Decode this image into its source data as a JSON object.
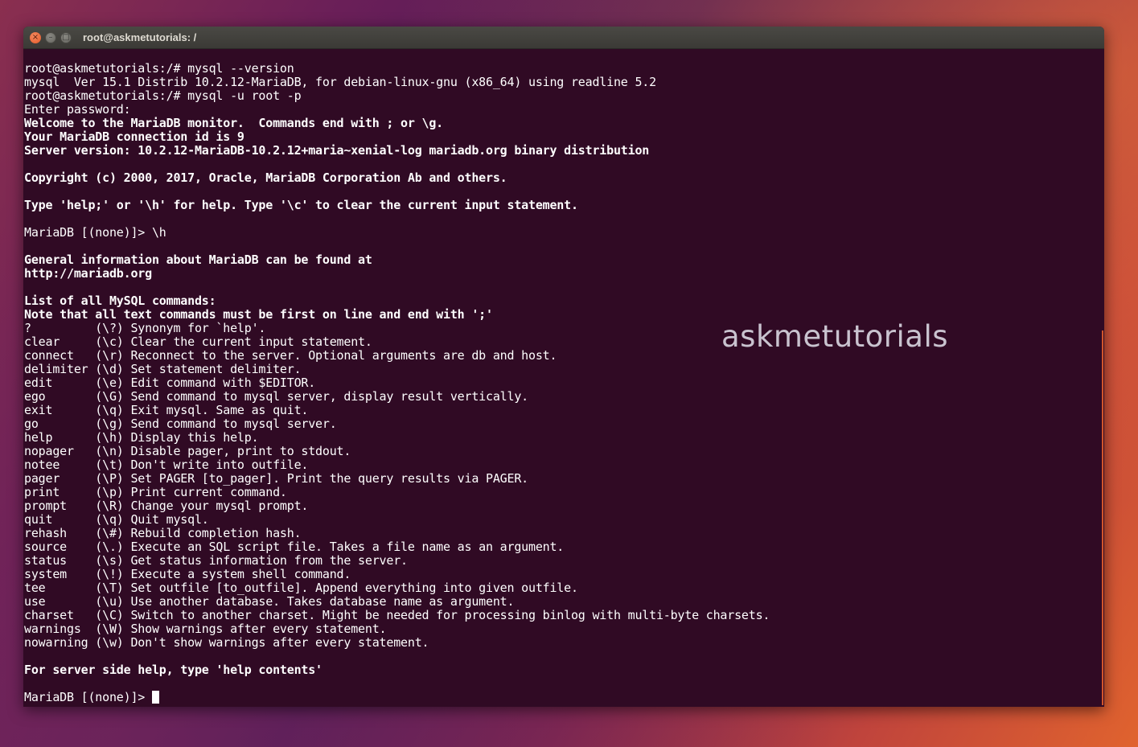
{
  "window": {
    "title": "root@askmetutorials: /",
    "buttons": {
      "close": "×",
      "minimize": "–",
      "maximize": "□"
    }
  },
  "watermark": "askmetutorials",
  "terminal": {
    "lines": [
      {
        "text": "root@askmetutorials:/# mysql --version",
        "bold": false
      },
      {
        "text": "mysql  Ver 15.1 Distrib 10.2.12-MariaDB, for debian-linux-gnu (x86_64) using readline 5.2",
        "bold": false
      },
      {
        "text": "root@askmetutorials:/# mysql -u root -p",
        "bold": false
      },
      {
        "text": "Enter password:",
        "bold": false
      },
      {
        "text": "Welcome to the MariaDB monitor.  Commands end with ; or \\g.",
        "bold": true
      },
      {
        "text": "Your MariaDB connection id is 9",
        "bold": true
      },
      {
        "text": "Server version: 10.2.12-MariaDB-10.2.12+maria~xenial-log mariadb.org binary distribution",
        "bold": true
      },
      {
        "text": "",
        "bold": false
      },
      {
        "text": "Copyright (c) 2000, 2017, Oracle, MariaDB Corporation Ab and others.",
        "bold": true
      },
      {
        "text": "",
        "bold": false
      },
      {
        "text": "Type 'help;' or '\\h' for help. Type '\\c' to clear the current input statement.",
        "bold": true
      },
      {
        "text": "",
        "bold": false
      },
      {
        "text": "MariaDB [(none)]> \\h",
        "bold": false
      },
      {
        "text": "",
        "bold": false
      },
      {
        "text": "General information about MariaDB can be found at",
        "bold": true
      },
      {
        "text": "http://mariadb.org",
        "bold": true
      },
      {
        "text": "",
        "bold": false
      },
      {
        "text": "List of all MySQL commands:",
        "bold": true
      },
      {
        "text": "Note that all text commands must be first on line and end with ';'",
        "bold": true
      },
      {
        "text": "?         (\\?) Synonym for `help'.",
        "bold": false
      },
      {
        "text": "clear     (\\c) Clear the current input statement.",
        "bold": false
      },
      {
        "text": "connect   (\\r) Reconnect to the server. Optional arguments are db and host.",
        "bold": false
      },
      {
        "text": "delimiter (\\d) Set statement delimiter.",
        "bold": false
      },
      {
        "text": "edit      (\\e) Edit command with $EDITOR.",
        "bold": false
      },
      {
        "text": "ego       (\\G) Send command to mysql server, display result vertically.",
        "bold": false
      },
      {
        "text": "exit      (\\q) Exit mysql. Same as quit.",
        "bold": false
      },
      {
        "text": "go        (\\g) Send command to mysql server.",
        "bold": false
      },
      {
        "text": "help      (\\h) Display this help.",
        "bold": false
      },
      {
        "text": "nopager   (\\n) Disable pager, print to stdout.",
        "bold": false
      },
      {
        "text": "notee     (\\t) Don't write into outfile.",
        "bold": false
      },
      {
        "text": "pager     (\\P) Set PAGER [to_pager]. Print the query results via PAGER.",
        "bold": false
      },
      {
        "text": "print     (\\p) Print current command.",
        "bold": false
      },
      {
        "text": "prompt    (\\R) Change your mysql prompt.",
        "bold": false
      },
      {
        "text": "quit      (\\q) Quit mysql.",
        "bold": false
      },
      {
        "text": "rehash    (\\#) Rebuild completion hash.",
        "bold": false
      },
      {
        "text": "source    (\\.) Execute an SQL script file. Takes a file name as an argument.",
        "bold": false
      },
      {
        "text": "status    (\\s) Get status information from the server.",
        "bold": false
      },
      {
        "text": "system    (\\!) Execute a system shell command.",
        "bold": false
      },
      {
        "text": "tee       (\\T) Set outfile [to_outfile]. Append everything into given outfile.",
        "bold": false
      },
      {
        "text": "use       (\\u) Use another database. Takes database name as argument.",
        "bold": false
      },
      {
        "text": "charset   (\\C) Switch to another charset. Might be needed for processing binlog with multi-byte charsets.",
        "bold": false
      },
      {
        "text": "warnings  (\\W) Show warnings after every statement.",
        "bold": false
      },
      {
        "text": "nowarning (\\w) Don't show warnings after every statement.",
        "bold": false
      },
      {
        "text": "",
        "bold": false
      },
      {
        "text": "For server side help, type 'help contents'",
        "bold": true
      },
      {
        "text": "",
        "bold": false
      }
    ],
    "prompt": "MariaDB [(none)]> "
  }
}
